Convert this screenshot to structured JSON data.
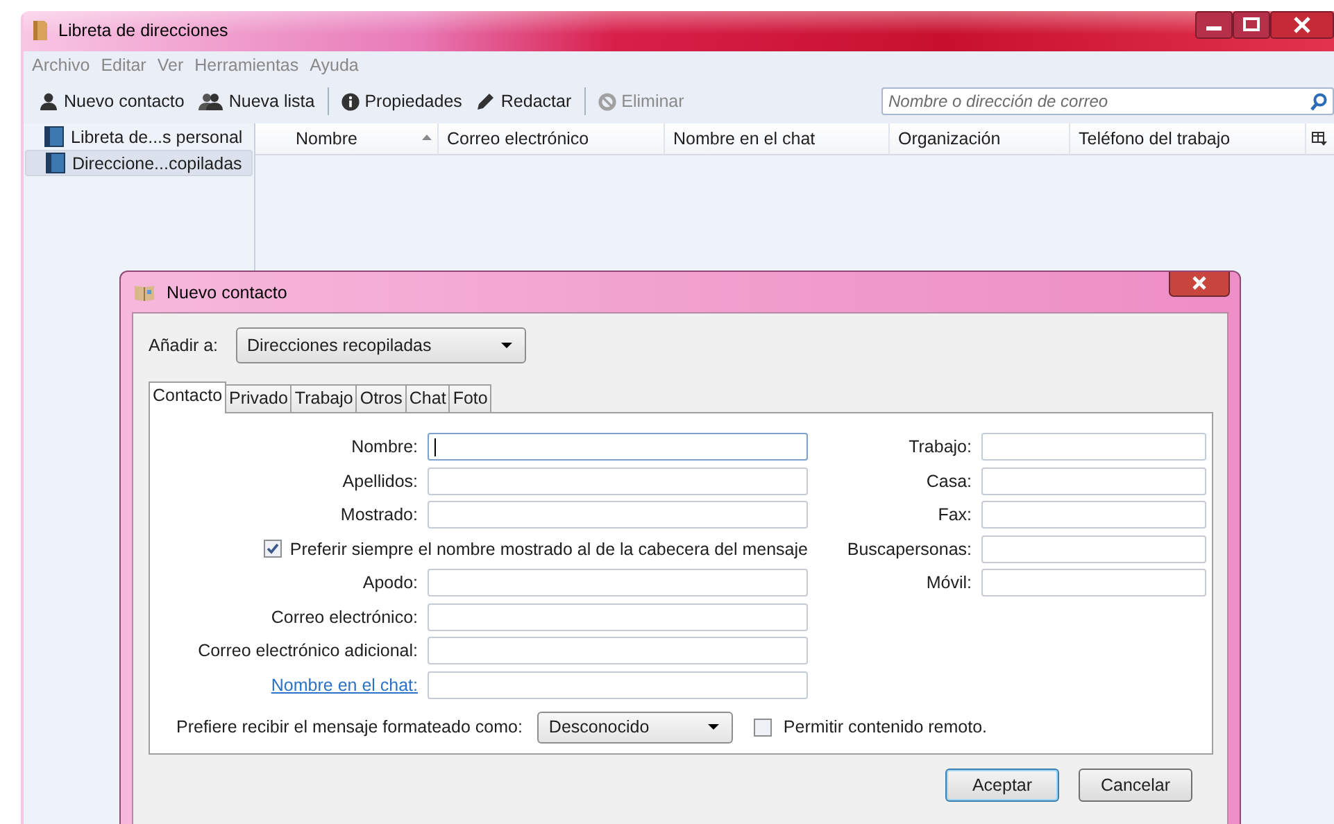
{
  "window": {
    "title": "Libreta de direcciones"
  },
  "menu": [
    {
      "label": "Archivo"
    },
    {
      "label": "Editar"
    },
    {
      "label": "Ver"
    },
    {
      "label": "Herramientas"
    },
    {
      "label": "Ayuda"
    }
  ],
  "toolbar": [
    {
      "kind": "person",
      "label": "Nuevo contacto",
      "disabled": false
    },
    {
      "kind": "people",
      "label": "Nueva lista",
      "disabled": false
    },
    {
      "kind": "separator"
    },
    {
      "kind": "info",
      "label": "Propiedades",
      "disabled": false
    },
    {
      "kind": "pencil",
      "label": "Redactar",
      "disabled": false
    },
    {
      "kind": "separator"
    },
    {
      "kind": "delete",
      "label": "Eliminar",
      "disabled": true
    }
  ],
  "search": {
    "placeholder": "Nombre o dirección de correo"
  },
  "sidebar": {
    "items": [
      {
        "label": "Libreta de...s personal",
        "selected": false
      },
      {
        "label": "Direccione...copiladas",
        "selected": true
      }
    ]
  },
  "table": {
    "columns": [
      {
        "label": "Nombre",
        "sorted": true
      },
      {
        "label": "Correo electrónico",
        "sorted": false
      },
      {
        "label": "Nombre en el chat",
        "sorted": false
      },
      {
        "label": "Organización",
        "sorted": false
      },
      {
        "label": "Teléfono del trabajo",
        "sorted": false
      }
    ]
  },
  "dialog": {
    "title": "Nuevo contacto",
    "add_to": {
      "label": "Añadir a:",
      "value": "Direcciones recopiladas"
    },
    "tabs": [
      {
        "label": "Contacto",
        "selected": true
      },
      {
        "label": "Privado",
        "selected": false
      },
      {
        "label": "Trabajo",
        "selected": false
      },
      {
        "label": "Otros",
        "selected": false
      },
      {
        "label": "Chat",
        "selected": false
      },
      {
        "label": "Foto",
        "selected": false
      }
    ],
    "left_fields": [
      {
        "kind": "text",
        "label": "Nombre:",
        "focused": true,
        "link": false
      },
      {
        "kind": "text",
        "label": "Apellidos:",
        "focused": false,
        "link": false
      },
      {
        "kind": "text",
        "label": "Mostrado:",
        "focused": false,
        "link": false
      },
      {
        "kind": "checkbox",
        "label": "Preferir siempre el nombre mostrado al de la cabecera del mensaje",
        "checked": true
      },
      {
        "kind": "text",
        "label": "Apodo:",
        "focused": false,
        "link": false
      },
      {
        "kind": "text",
        "label": "Correo electrónico:",
        "focused": false,
        "link": false
      },
      {
        "kind": "text",
        "label": "Correo electrónico adicional:",
        "focused": false,
        "link": false
      },
      {
        "kind": "text",
        "label": "Nombre en el chat:",
        "focused": false,
        "link": true
      }
    ],
    "right_fields": [
      {
        "label": "Trabajo:"
      },
      {
        "label": "Casa:"
      },
      {
        "label": "Fax:"
      },
      {
        "label": "Buscapersonas:"
      },
      {
        "label": "Móvil:"
      }
    ],
    "format": {
      "label": "Prefiere recibir el mensaje formateado como:",
      "value": "Desconocido"
    },
    "remote": {
      "label": "Permitir contenido remoto.",
      "checked": false
    },
    "buttons": [
      {
        "label": "Aceptar",
        "default": true
      },
      {
        "label": "Cancelar",
        "default": false
      }
    ]
  }
}
